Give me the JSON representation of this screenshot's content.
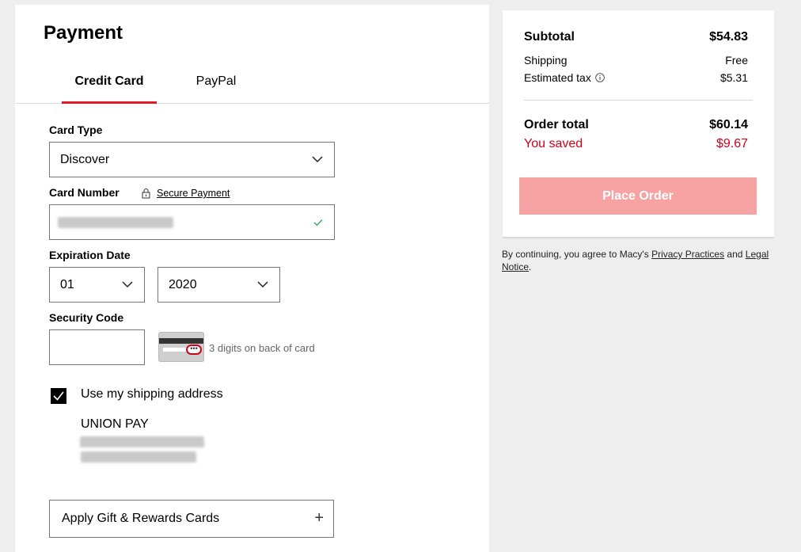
{
  "payment": {
    "title": "Payment",
    "tabs": [
      {
        "label": "Credit Card",
        "active": true
      },
      {
        "label": "PayPal",
        "active": false
      }
    ],
    "card_type": {
      "label": "Card Type",
      "value": "Discover"
    },
    "card_number": {
      "label": "Card Number",
      "secure_label": "Secure Payment",
      "value_obscured": true
    },
    "expiration": {
      "label": "Expiration Date",
      "month": "01",
      "year": "2020"
    },
    "security_code": {
      "label": "Security Code",
      "value": "",
      "hint": "3 digits on back of card"
    },
    "shipping_address": {
      "label": "Use my shipping address",
      "checked": true,
      "name": "UNION PAY"
    },
    "gift_cards": {
      "label": "Apply Gift & Rewards Cards",
      "icon": "plus-icon"
    }
  },
  "summary": {
    "subtotal": {
      "label": "Subtotal",
      "value": "$54.83"
    },
    "shipping": {
      "label": "Shipping",
      "value": "Free"
    },
    "tax": {
      "label": "Estimated tax",
      "value": "$5.31",
      "icon": "info-icon"
    },
    "order_total": {
      "label": "Order total",
      "value": "$60.14"
    },
    "saved": {
      "label": "You saved",
      "value": "$9.67"
    },
    "place_order": "Place Order"
  },
  "legal": {
    "prefix": "By continuing, you agree to Macy's ",
    "privacy": "Privacy Practices",
    "and": " and ",
    "notice": "Legal Notice",
    "suffix": "."
  },
  "colors": {
    "accent": "#e01a2b",
    "button_disabled": "#f7a3a3",
    "saved": "#d0021b"
  }
}
